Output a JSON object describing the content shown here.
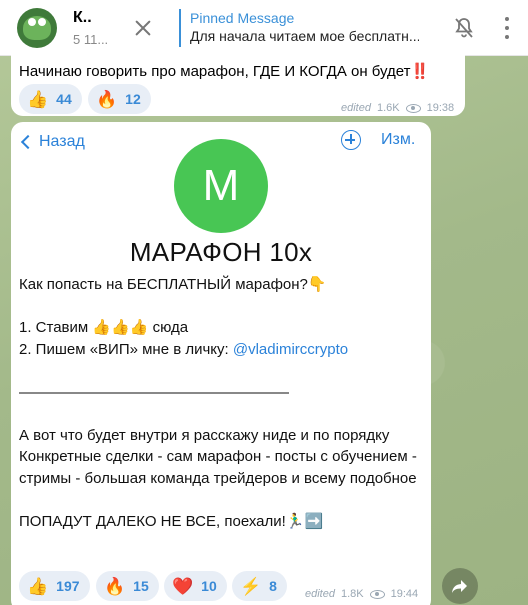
{
  "header": {
    "channel_name": "К..",
    "channel_sub": "5 11...",
    "pinned_title": "Pinned Message",
    "pinned_text": "Для начала читаем мое бесплатн..."
  },
  "message1": {
    "text": "Начинаю говорить про марафон, ГДЕ И КОГДА он будет",
    "exclaim": "‼️",
    "reactions": [
      {
        "emoji": "👍",
        "count": "44"
      },
      {
        "emoji": "🔥",
        "count": "12"
      }
    ],
    "edited": "edited",
    "views": "1.6K",
    "time": "19:38"
  },
  "message2": {
    "back_label": "Назад",
    "edit_label": "Изм.",
    "avatar_letter": "M",
    "channel_title": "МАРАФОН 10х",
    "lines": [
      "Как попасть на БЕСПЛАТНЫЙ марафон?👇",
      "",
      "1. Ставим 👍👍👍 сюда",
      "2. Пишем «ВИП» мне в личку: ",
      "",
      "——————————————————",
      "",
      "А вот что будет внутри я расскажу ниде и по порядку",
      "Конкретные сделки - сам марафон - посты с обучением - стримы - большая команда трейдеров и всему подобное",
      "",
      "ПОПАДУТ ДАЛЕКО НЕ ВСЕ, поехали!🏃‍♂️➡️"
    ],
    "link": "@vladimirccrypto",
    "reactions": [
      {
        "emoji": "👍",
        "count": "197"
      },
      {
        "emoji": "🔥",
        "count": "15"
      },
      {
        "emoji": "❤️",
        "count": "10"
      },
      {
        "emoji": "⚡",
        "count": "8"
      }
    ],
    "edited": "edited",
    "views": "1.8K",
    "time": "19:44"
  },
  "colors": {
    "accent": "#2b82d9",
    "avatar_green": "#48c654",
    "reaction_bg": "#e8eef6"
  }
}
